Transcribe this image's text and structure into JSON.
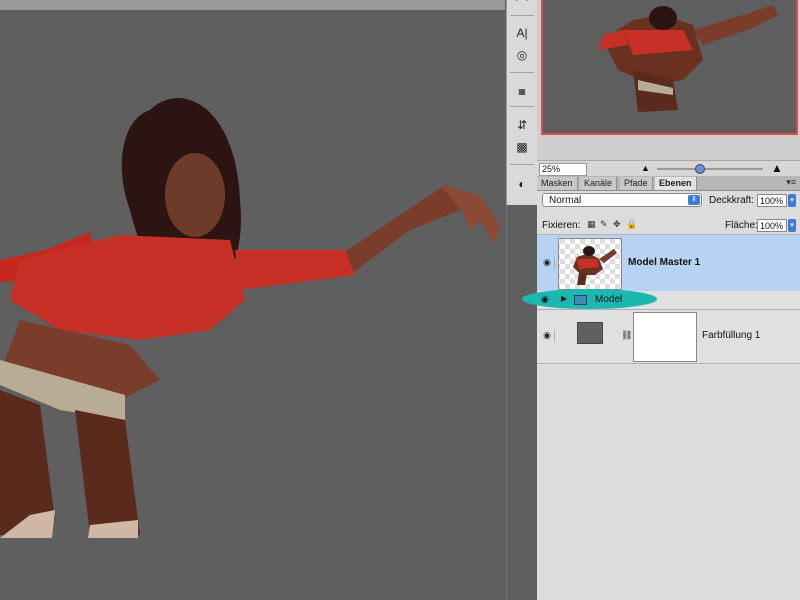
{
  "navigator": {
    "zoom": "25%"
  },
  "layers_panel": {
    "tabs": [
      {
        "label": "Masken",
        "active": false
      },
      {
        "label": "Kanäle",
        "active": false
      },
      {
        "label": "Pfade",
        "active": false
      },
      {
        "label": "Ebenen",
        "active": true
      }
    ],
    "blend_mode": "Normal",
    "opacity_label": "Deckkraft:",
    "opacity_value": "100%",
    "lock_label": "Fixieren:",
    "fill_label": "Fläche:",
    "fill_value": "100%",
    "layers": [
      {
        "name": "Model Master 1",
        "selected": true
      },
      {
        "name": "Model",
        "type": "group"
      },
      {
        "name": "Farbfüllung 1"
      }
    ]
  },
  "colors": {
    "canvas_bg": "#5f5f5f",
    "selected_layer": "#b7d3f4",
    "group_highlight": "#1bb8b0",
    "navigator_frame": "#e24a4a"
  },
  "icons": {
    "tools": [
      "text-icon",
      "rotate-icon",
      "paragraph-icon",
      "usb-icon",
      "grid-icon",
      "brush-icon"
    ]
  }
}
